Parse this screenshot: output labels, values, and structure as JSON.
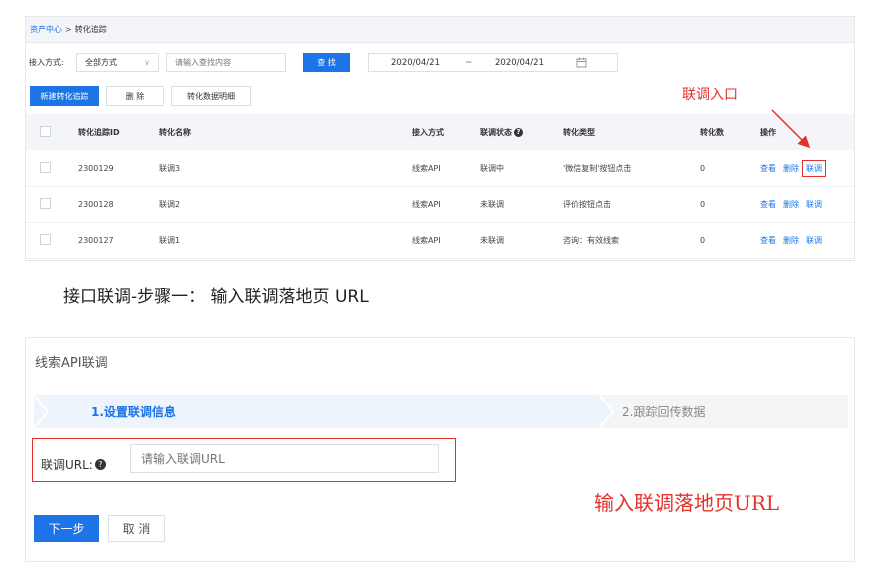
{
  "breadcrumb": {
    "root": "资产中心",
    "separator": ">",
    "current": "转化追踪"
  },
  "filter": {
    "access_label": "接入方式:",
    "access_select": "全部方式",
    "search_placeholder": "请输入查找内容",
    "search_button": "查 找",
    "date_start": "2020/04/21",
    "date_sep": "~",
    "date_end": "2020/04/21"
  },
  "actions": {
    "new": "新建转化追踪",
    "delete": "删 除",
    "detail": "转化数据明细"
  },
  "annotation_top": "联调入口",
  "table": {
    "headers": [
      "转化追踪ID",
      "转化名称",
      "接入方式",
      "联调状态",
      "转化类型",
      "转化数",
      "操作"
    ],
    "rows": [
      {
        "id": "2300129",
        "name": "联调3",
        "access": "线索API",
        "status": "联调中",
        "type": "'微信复制'按钮点击",
        "count": "0"
      },
      {
        "id": "2300128",
        "name": "联调2",
        "access": "线索API",
        "status": "未联调",
        "type": "评价按钮点击",
        "count": "0"
      },
      {
        "id": "2300127",
        "name": "联调1",
        "access": "线索API",
        "status": "未联调",
        "type": "咨询：有效线索",
        "count": "0"
      }
    ],
    "ops": {
      "view": "查看",
      "delete": "删除",
      "debug": "联调"
    }
  },
  "step_heading": "接口联调-步骤一：   输入联调落地页 URL",
  "panel2": {
    "title": "线索API联调",
    "step1": "1.设置联调信息",
    "step2": "2.跟踪回传数据",
    "url_label": "联调URL:",
    "url_placeholder": "请输入联调URL",
    "next": "下一步",
    "cancel": "取 消"
  },
  "annotation_bottom": "输入联调落地页URL",
  "colors": {
    "primary": "#1d74e7",
    "annotation": "#e5312b"
  }
}
